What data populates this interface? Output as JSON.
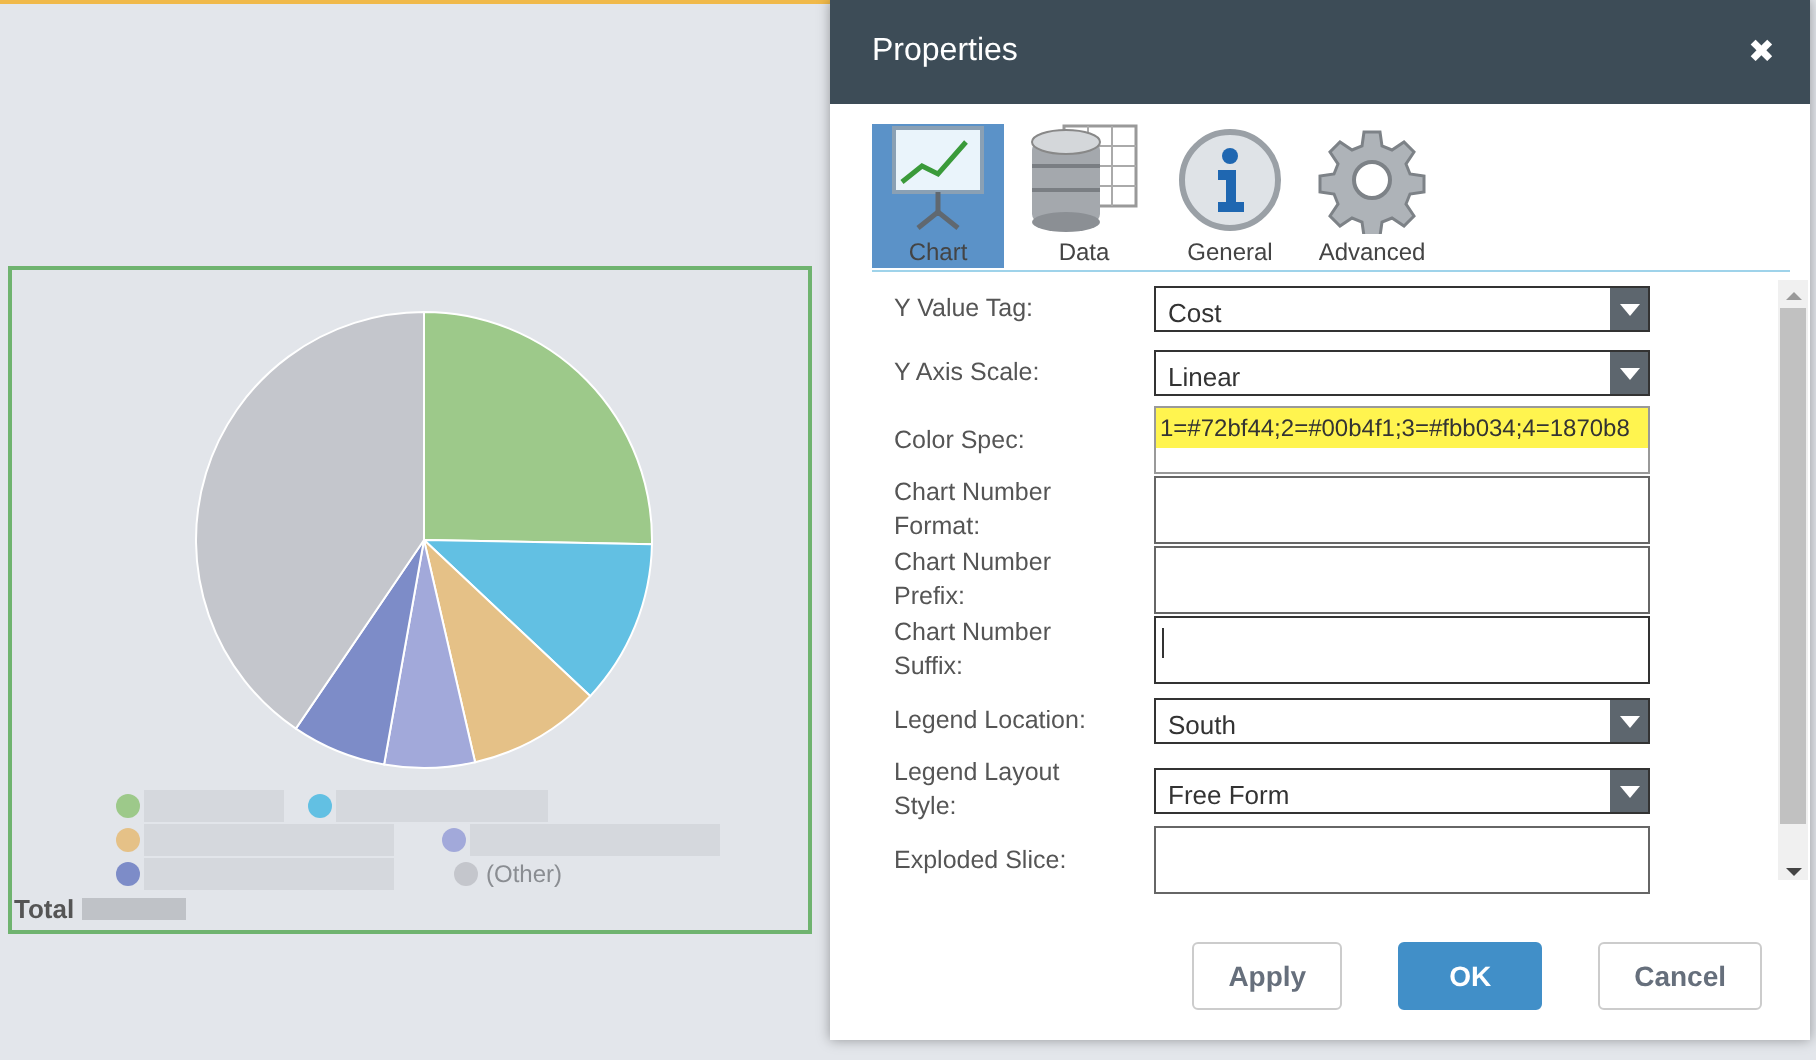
{
  "chart_panel": {
    "pie_slices": [
      {
        "color": "#9dc98a"
      },
      {
        "color": "#62c0e3"
      },
      {
        "color": "#e5c187"
      },
      {
        "color": "#a2a9da"
      },
      {
        "color": "#7d8cc8"
      },
      {
        "color": "#c4c6cc"
      }
    ],
    "legend_rows": [
      [
        {
          "kind": "redacted",
          "color": "#9dc98a"
        },
        {
          "kind": "redacted",
          "color": "#62c0e3"
        }
      ],
      [
        {
          "kind": "redacted",
          "color": "#e5c187"
        },
        {
          "kind": "redacted",
          "color": "#a2a9da"
        }
      ],
      [
        {
          "kind": "redacted",
          "color": "#7d8cc8"
        },
        {
          "kind": "text",
          "color": "#c4c6cc",
          "label": "(Other)"
        }
      ]
    ],
    "total_label": "Total"
  },
  "dialog": {
    "title": "Properties",
    "close": "✖",
    "tabs": [
      {
        "kind": "chart",
        "label": "Chart",
        "selected": true
      },
      {
        "kind": "data",
        "label": "Data",
        "selected": false
      },
      {
        "kind": "info",
        "label": "General",
        "selected": false
      },
      {
        "kind": "gear",
        "label": "Advanced",
        "selected": false
      }
    ],
    "fields": [
      {
        "kind": "select",
        "label": "Y Value Tag:",
        "value": "Cost"
      },
      {
        "kind": "select",
        "label": "Y Axis Scale:",
        "value": "Linear"
      },
      {
        "kind": "text",
        "label": "Color Spec:",
        "value": "1=#72bf44;2=#00b4f1;3=#fbb034;4=1870b8",
        "highlighted": true,
        "focused": false
      },
      {
        "kind": "text",
        "label": "Chart Number Format:",
        "highlighted": false,
        "focused": false
      },
      {
        "kind": "text",
        "label": "Chart Number Prefix:",
        "highlighted": false,
        "focused": false
      },
      {
        "kind": "text",
        "label": "Chart Number Suffix:",
        "highlighted": false,
        "focused": true
      },
      {
        "kind": "select",
        "label": "Legend Location:",
        "value": "South"
      },
      {
        "kind": "select",
        "label": "Legend Layout Style:",
        "value": "Free Form"
      },
      {
        "kind": "text",
        "label": "Exploded Slice:",
        "highlighted": false,
        "focused": false
      }
    ],
    "buttons": [
      {
        "kind": "secondary",
        "label": "Apply"
      },
      {
        "kind": "primary",
        "label": "OK"
      },
      {
        "kind": "secondary",
        "label": "Cancel"
      }
    ]
  }
}
